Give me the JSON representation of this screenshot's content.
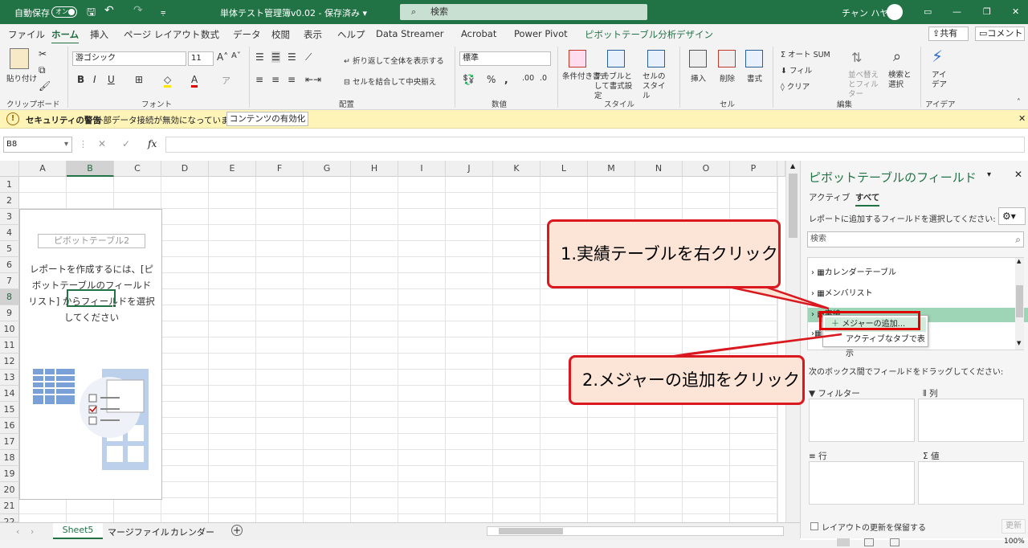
{
  "titlebar": {
    "autosave_label": "自動保存",
    "autosave_state": "オン",
    "filename": "単体テスト管理簿v0.02 - 保存済み ▾",
    "search_placeholder": "検索",
    "user_name": "チャン ハヤミ"
  },
  "ribbon_tabs": [
    "ファイル",
    "ホーム",
    "挿入",
    "ページ レイアウト",
    "数式",
    "データ",
    "校閲",
    "表示",
    "ヘルプ",
    "Data Streamer",
    "Acrobat",
    "Power Pivot",
    "ピボットテーブル分析",
    "デザイン"
  ],
  "share_label": "共有",
  "comment_label": "コメント",
  "ribbon": {
    "clipboard": {
      "paste": "貼り付け",
      "group": "クリップボード"
    },
    "font": {
      "name": "游ゴシック",
      "size": "11",
      "group": "フォント"
    },
    "alignment": {
      "wrap": "折り返して全体を表示する",
      "merge": "セルを結合して中央揃え",
      "group": "配置"
    },
    "number": {
      "format": "標準",
      "group": "数値"
    },
    "styles": {
      "cond": "条件付き書式",
      "table": "テーブルとして書式設定",
      "cell": "セルのスタイル",
      "group": "スタイル"
    },
    "cells": {
      "insert": "挿入",
      "delete": "削除",
      "format": "書式",
      "group": "セル"
    },
    "editing": {
      "autosum": "オート SUM",
      "fill": "フィル",
      "clear": "クリア",
      "sort": "並べ替えとフィルター",
      "find": "検索と選択",
      "group": "編集"
    },
    "ideas": {
      "label": "アイデア",
      "group": "アイデア"
    }
  },
  "security_bar": {
    "title": "セキュリティの警告",
    "message": "外部データ接続が無効になっています",
    "button": "コンテンツの有効化"
  },
  "formula_bar": {
    "namebox": "B8",
    "fx": "fx"
  },
  "columns": [
    "A",
    "B",
    "C",
    "D",
    "E",
    "F",
    "G",
    "H",
    "I",
    "J",
    "K",
    "L",
    "M",
    "N",
    "O",
    "P"
  ],
  "rows": [
    "1",
    "2",
    "3",
    "4",
    "5",
    "6",
    "7",
    "8",
    "9",
    "10",
    "11",
    "12",
    "13",
    "14",
    "15",
    "16",
    "17",
    "18",
    "19",
    "20",
    "21",
    "22"
  ],
  "pivot_placeholder": {
    "name": "ピボットテーブル2",
    "line1": "レポートを作成するには、[ピ",
    "line2": "ボットテーブルのフィールド",
    "line3": "リスト] からフィールドを選択",
    "line4": "してください"
  },
  "pane": {
    "title": "ピボットテーブルのフィールド",
    "tab_active": "アクティブ",
    "tab_all": "すべて",
    "choose_label": "レポートに追加するフィールドを選択してください:",
    "search_placeholder": "検索",
    "fields": [
      "カレンダーテーブル",
      "メンバリスト",
      "実績"
    ],
    "drag_label": "次のボックス間でフィールドをドラッグしてください:",
    "filters": "フィルター",
    "columns": "列",
    "rows": "行",
    "values": "値",
    "defer": "レイアウトの更新を保留する",
    "update": "更新"
  },
  "context_menu": {
    "add_measure": "メジャーの追加...",
    "show_active": "アクティブなタブで表示"
  },
  "callouts": {
    "step1": "1.実績テーブルを右クリック",
    "step2": "2.メジャーの追加をクリック"
  },
  "sheets": [
    "Sheet5",
    "マージファイル",
    "カレンダー"
  ],
  "status": {
    "zoom": "100%"
  }
}
